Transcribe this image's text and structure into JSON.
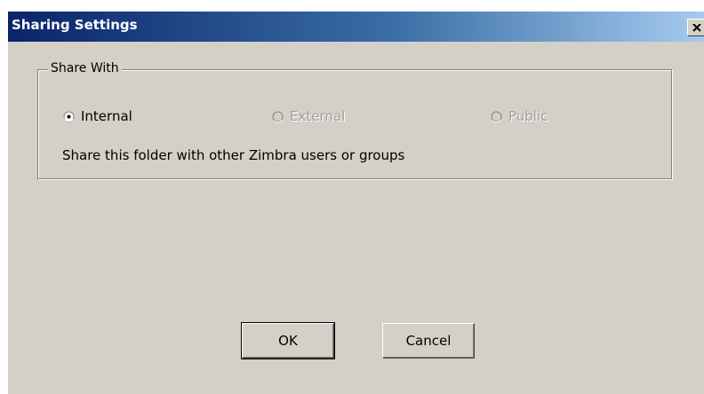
{
  "window": {
    "title": "Sharing Settings",
    "close_glyph": "close-icon"
  },
  "share_with": {
    "legend": "Share With",
    "options": [
      {
        "label": "Internal",
        "selected": true,
        "enabled": true
      },
      {
        "label": "External",
        "selected": false,
        "enabled": false
      },
      {
        "label": "Public",
        "selected": false,
        "enabled": false
      }
    ],
    "description": "Share this folder with other Zimbra users or groups"
  },
  "buttons": {
    "ok_label": "OK",
    "cancel_label": "Cancel"
  },
  "colors": {
    "dialog_bg": "#d4d0c8",
    "titlebar_start": "#0a246a",
    "titlebar_end": "#a6caf0",
    "disabled_text": "#a0a0a0"
  }
}
